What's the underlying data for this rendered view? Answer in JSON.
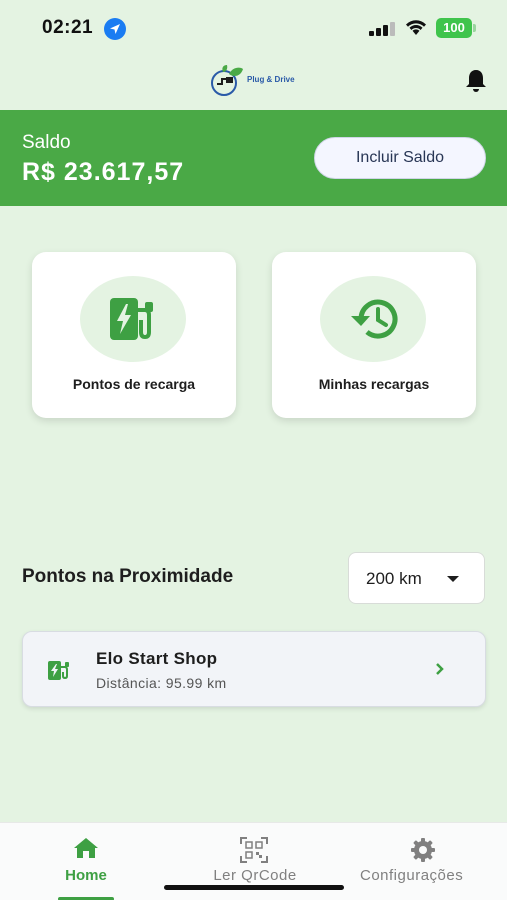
{
  "status_bar": {
    "time": "02:21",
    "battery": "100"
  },
  "header": {
    "logo_text": "Plug & Drive"
  },
  "balance": {
    "label": "Saldo",
    "value": "R$ 23.617,57",
    "add_button": "Incluir Saldo"
  },
  "cards": [
    {
      "label": "Pontos de recarga",
      "icon": "charging-station-icon"
    },
    {
      "label": "Minhas recargas",
      "icon": "history-icon"
    }
  ],
  "nearby": {
    "title": "Pontos na Proximidade",
    "distance_filter": "200 km",
    "stations": [
      {
        "name": "Elo Start Shop",
        "distance": "Distância: 95.99 km"
      }
    ]
  },
  "bottom_nav": {
    "items": [
      {
        "label": "Home",
        "icon": "home-icon",
        "active": true
      },
      {
        "label": "Ler QrCode",
        "icon": "qrcode-icon",
        "active": false
      },
      {
        "label": "Configurações",
        "icon": "gear-icon",
        "active": false
      }
    ]
  },
  "colors": {
    "primary": "#4aa946",
    "background": "#e4f3e2",
    "accent_text": "#3ea043"
  }
}
